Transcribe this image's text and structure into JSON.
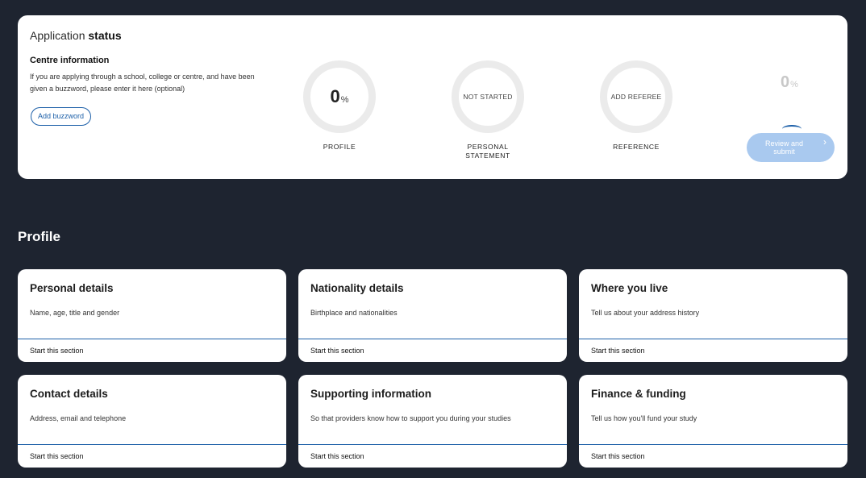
{
  "status": {
    "title_normal": "Application",
    "title_bold": "status",
    "centre_heading": "Centre information",
    "centre_desc": "If you are applying through a school, college or centre, and have been given a buzzword, please enter it here (optional)",
    "buzzword_button": "Add buzzword",
    "rings": [
      {
        "number": "0",
        "suffix": "%",
        "text": "",
        "label": "PROFILE"
      },
      {
        "number": "",
        "suffix": "",
        "text": "NOT STARTED",
        "label": "PERSONAL STATEMENT"
      },
      {
        "number": "",
        "suffix": "",
        "text": "ADD REFEREE",
        "label": "REFERENCE"
      }
    ],
    "overall": {
      "number": "0",
      "suffix": "%"
    },
    "review_button": "Review and submit",
    "chevron_icon": "chevron-right-icon",
    "colors": {
      "accent": "#1c5fa8",
      "review_bg": "#a9c9ef",
      "ring_track": "#ebebeb",
      "page_bg": "#1e2430"
    }
  },
  "profile": {
    "heading": "Profile",
    "cards": [
      {
        "title": "Personal details",
        "desc": "Name, age, title and gender",
        "link": "Start this section"
      },
      {
        "title": "Nationality details",
        "desc": "Birthplace and nationalities",
        "link": "Start this section"
      },
      {
        "title": "Where you live",
        "desc": "Tell us about your address history",
        "link": "Start this section"
      },
      {
        "title": "Contact details",
        "desc": "Address, email and telephone",
        "link": "Start this section"
      },
      {
        "title": "Supporting information",
        "desc": "So that providers know how to support you during your studies",
        "link": "Start this section"
      },
      {
        "title": "Finance & funding",
        "desc": "Tell us how you'll fund your study",
        "link": "Start this section"
      }
    ]
  }
}
